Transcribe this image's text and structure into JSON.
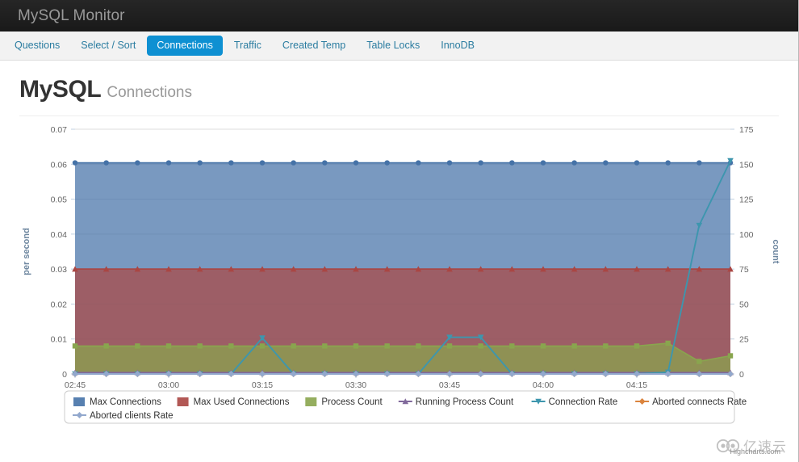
{
  "navbar": {
    "brand": "MySQL Monitor"
  },
  "tabs": [
    {
      "label": "Questions",
      "active": false
    },
    {
      "label": "Select / Sort",
      "active": false
    },
    {
      "label": "Connections",
      "active": true
    },
    {
      "label": "Traffic",
      "active": false
    },
    {
      "label": "Created Temp",
      "active": false
    },
    {
      "label": "Table Locks",
      "active": false
    },
    {
      "label": "InnoDB",
      "active": false
    }
  ],
  "header": {
    "title": "MySQL",
    "subtitle": "Connections"
  },
  "credit": {
    "text": "Highcharts.com"
  },
  "watermark": {
    "text": "亿速云"
  },
  "colors": {
    "accent": "#0e90d2",
    "link": "#2a7ca0",
    "navbar_bg": "#1f1f1f",
    "axis_label": "#6d869f",
    "tick_text": "#666666",
    "max_connections": "#4572a7",
    "max_used_connections": "#aa4643",
    "process_count": "#89a54e",
    "running_process_count": "#80699b",
    "connection_rate": "#3d96ae",
    "aborted_connects_rate": "#db843d",
    "aborted_clients_rate": "#92a8cd"
  },
  "chart_data": {
    "type": "area",
    "title": "",
    "xlabel": "",
    "ylabel": "per second",
    "y2label": "count",
    "ylim": [
      0,
      0.07
    ],
    "ytick_step": 0.01,
    "yticks": [
      "0",
      "0.01",
      "0.02",
      "0.03",
      "0.04",
      "0.05",
      "0.06",
      "0.07"
    ],
    "y2lim": [
      0,
      175
    ],
    "y2tick_step": 25,
    "y2ticks": [
      "0",
      "25",
      "50",
      "75",
      "100",
      "125",
      "150",
      "175"
    ],
    "grid": true,
    "legend_position": "bottom",
    "xticks": [
      "02:45",
      "03:00",
      "03:15",
      "03:30",
      "03:45",
      "04:00",
      "04:15"
    ],
    "x_start": "02:45",
    "x_end": "04:30",
    "x": [
      0,
      5,
      10,
      15,
      20,
      25,
      30,
      35,
      40,
      45,
      50,
      55,
      60,
      65,
      70,
      75,
      80,
      85,
      90,
      95,
      100,
      105
    ],
    "series": [
      {
        "name": "Max Connections",
        "axis": "right",
        "color": "#4572a7",
        "marker": "circle",
        "values": [
          151,
          151,
          151,
          151,
          151,
          151,
          151,
          151,
          151,
          151,
          151,
          151,
          151,
          151,
          151,
          151,
          151,
          151,
          151,
          151,
          151,
          151
        ]
      },
      {
        "name": "Max Used Connections",
        "axis": "right",
        "color": "#aa4643",
        "marker": "triangle",
        "values": [
          75,
          75,
          75,
          75,
          75,
          75,
          75,
          75,
          75,
          75,
          75,
          75,
          75,
          75,
          75,
          75,
          75,
          75,
          75,
          75,
          75,
          75
        ]
      },
      {
        "name": "Process Count",
        "axis": "right",
        "color": "#89a54e",
        "marker": "square",
        "values": [
          20,
          20,
          20,
          20,
          20,
          20,
          20,
          20,
          20,
          20,
          20,
          20,
          20,
          20,
          20,
          20,
          20,
          20,
          20,
          22,
          9,
          13
        ]
      },
      {
        "name": "Running Process Count",
        "axis": "right",
        "color": "#80699b",
        "marker": "triangle",
        "values": [
          1,
          1,
          1,
          1,
          1,
          1,
          1,
          1,
          1,
          1,
          1,
          1,
          1,
          1,
          1,
          1,
          1,
          1,
          1,
          1,
          1,
          1
        ]
      },
      {
        "name": "Connection Rate",
        "axis": "left",
        "color": "#3d96ae",
        "marker": "triangle-down",
        "values": [
          0,
          0,
          0,
          0,
          0,
          0,
          0.0103,
          0,
          0,
          0,
          0,
          0,
          0.0105,
          0.0105,
          0,
          0,
          0,
          0,
          0,
          0.0005,
          0.0425,
          0.061
        ]
      },
      {
        "name": "Aborted connects Rate",
        "axis": "left",
        "color": "#db843d",
        "marker": "diamond",
        "values": [
          0,
          0,
          0,
          0,
          0,
          0,
          0,
          0,
          0,
          0,
          0,
          0,
          0,
          0,
          0,
          0,
          0,
          0,
          0,
          0,
          0,
          0
        ]
      },
      {
        "name": "Aborted clients Rate",
        "axis": "left",
        "color": "#92a8cd",
        "marker": "diamond",
        "values": [
          0,
          0,
          0,
          0,
          0,
          0,
          0,
          0,
          0,
          0,
          0,
          0,
          0,
          0,
          0,
          0,
          0,
          0,
          0,
          0,
          0,
          0
        ]
      }
    ]
  }
}
